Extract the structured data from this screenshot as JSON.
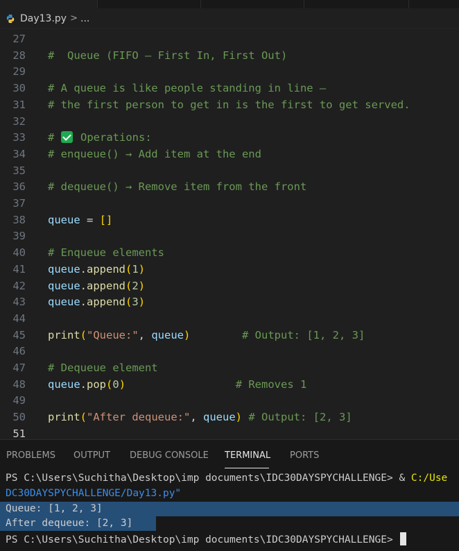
{
  "breadcrumb": {
    "file": "Day13.py",
    "separator": ">",
    "rest": "..."
  },
  "editor": {
    "lines": [
      {
        "n": "27"
      },
      {
        "n": "28",
        "c1": "#  Queue (FIFO – First In, First Out)"
      },
      {
        "n": "29"
      },
      {
        "n": "30",
        "c1": "# A queue is like people standing in line –"
      },
      {
        "n": "31",
        "c1": "# the first person to get in is the first to get served."
      },
      {
        "n": "32"
      },
      {
        "n": "33",
        "c1": "# ",
        "c2": " Operations:"
      },
      {
        "n": "34",
        "c1": "# enqueue() → Add item at the end"
      },
      {
        "n": "35"
      },
      {
        "n": "36",
        "c1": "# dequeue() → Remove item from the front"
      },
      {
        "n": "37"
      },
      {
        "n": "38",
        "v": "queue",
        "op": " = ",
        "br": "[]"
      },
      {
        "n": "39"
      },
      {
        "n": "40",
        "c1": "# Enqueue elements"
      },
      {
        "n": "41",
        "v": "queue",
        "dot": ".",
        "f": "append",
        "bo": "(",
        "num": "1",
        "bc": ")"
      },
      {
        "n": "42",
        "v": "queue",
        "dot": ".",
        "f": "append",
        "bo": "(",
        "num": "2",
        "bc": ")"
      },
      {
        "n": "43",
        "v": "queue",
        "dot": ".",
        "f": "append",
        "bo": "(",
        "num": "3",
        "bc": ")"
      },
      {
        "n": "44"
      },
      {
        "n": "45",
        "f": "print",
        "bo": "(",
        "s": "\"Queue:\"",
        "sep": ", ",
        "v": "queue",
        "bc": ")",
        "pad": "        ",
        "cm": "# Output: [1, 2, 3]"
      },
      {
        "n": "46"
      },
      {
        "n": "47",
        "c1": "# Dequeue element"
      },
      {
        "n": "48",
        "v": "queue",
        "dot": ".",
        "f": "pop",
        "bo": "(",
        "num": "0",
        "bc": ")",
        "pad": "                 ",
        "cm": "# Removes 1"
      },
      {
        "n": "49"
      },
      {
        "n": "50",
        "f": "print",
        "bo": "(",
        "s": "\"After dequeue:\"",
        "sep": ", ",
        "v": "queue",
        "bc": ")",
        "pad": " ",
        "cm": "# Output: [2, 3]"
      },
      {
        "n": "51"
      }
    ]
  },
  "panel": {
    "tabs": [
      "PROBLEMS",
      "OUTPUT",
      "DEBUG CONSOLE",
      "TERMINAL",
      "PORTS"
    ],
    "active": "TERMINAL"
  },
  "terminal": {
    "line1_prompt": "PS C:\\Users\\Suchitha\\Desktop\\imp documents\\IDC30DAYSPYCHALLENGE> ",
    "line1_amp": "& ",
    "line1_path": "C:/Use",
    "line2": "DC30DAYSPYCHALLENGE/Day13.py\"",
    "line3": "Queue: [1, 2, 3]",
    "line4": "After dequeue: [2, 3]",
    "line5_prompt": "PS C:\\Users\\Suchitha\\Desktop\\imp documents\\IDC30DAYSPYCHALLENGE> "
  },
  "colors": {
    "comment": "#6a9955",
    "variable": "#9cdcfe",
    "function": "#dcdcaa",
    "string": "#ce9178",
    "number": "#b5cea8",
    "bracket": "#ffd700",
    "selection": "#264f78",
    "check": "#1faa52"
  }
}
